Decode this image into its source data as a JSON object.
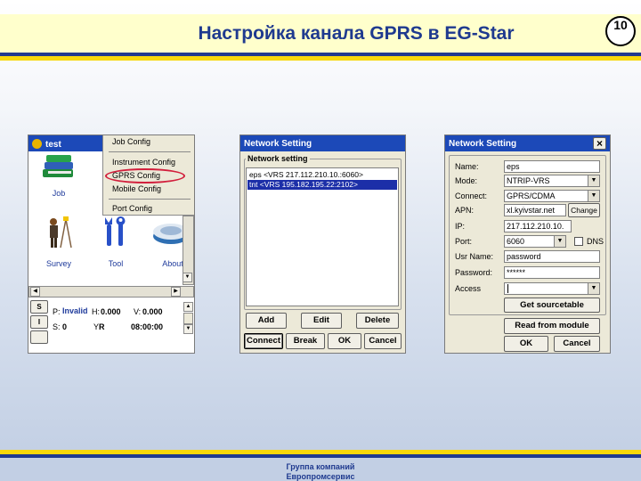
{
  "header": {
    "title": "Настройка канала GPRS в EG-Star",
    "slide_number": "10"
  },
  "footer": {
    "line1": "Группа компаний",
    "line2": "Европромсервис"
  },
  "window1": {
    "title": "test",
    "menu": [
      "Job Config",
      "Instrument Config",
      "GPRS Config",
      "Mobile Config",
      "Port Config"
    ],
    "icons": [
      {
        "label": "Job",
        "icon": "books-icon"
      },
      {
        "label": "Survey",
        "icon": "surveyor-icon"
      },
      {
        "label": "Tool",
        "icon": "tools-icon"
      },
      {
        "label": "About",
        "icon": "receiver-icon"
      }
    ],
    "status": {
      "s_label": "S",
      "i_label": "I",
      "p_label": "P:",
      "p_value": "Invalid",
      "h_label": "H:",
      "h_value": "0.000",
      "v_label": "V:",
      "v_value": "0.000",
      "s2_label": "S:",
      "s2_value": "0",
      "r_label": "R",
      "time": "08:00:00"
    }
  },
  "window2": {
    "title": "Network Setting",
    "group_label": "Network setting",
    "items": [
      "eps  <VRS  217.112.210.10.:6060>",
      "tnt  <VRS  195.182.195.22:2102>"
    ],
    "selected_index": 1,
    "buttons": {
      "add": "Add",
      "edit": "Edit",
      "delete": "Delete",
      "connect": "Connect",
      "break": "Break",
      "ok": "OK",
      "cancel": "Cancel"
    }
  },
  "window3": {
    "title": "Network Setting",
    "close": "×",
    "labels": {
      "name": "Name:",
      "mode": "Mode:",
      "connect": "Connect:",
      "apn": "APN:",
      "ip": "IP:",
      "port": "Port:",
      "usr": "Usr Name:",
      "password": "Password:",
      "access": "Access"
    },
    "values": {
      "name": "eps",
      "mode": "NTRIP-VRS",
      "connect": "GPRS/CDMA",
      "apn": "xl.kyivstar.net",
      "ip": "217.112.210.10.",
      "port": "6060",
      "usr": "password",
      "password": "******",
      "access": ""
    },
    "dns_label": "DNS",
    "buttons": {
      "change": "Change",
      "get_sourcetable": "Get sourcetable",
      "read_from_module": "Read from module",
      "ok": "OK",
      "cancel": "Cancel"
    }
  }
}
